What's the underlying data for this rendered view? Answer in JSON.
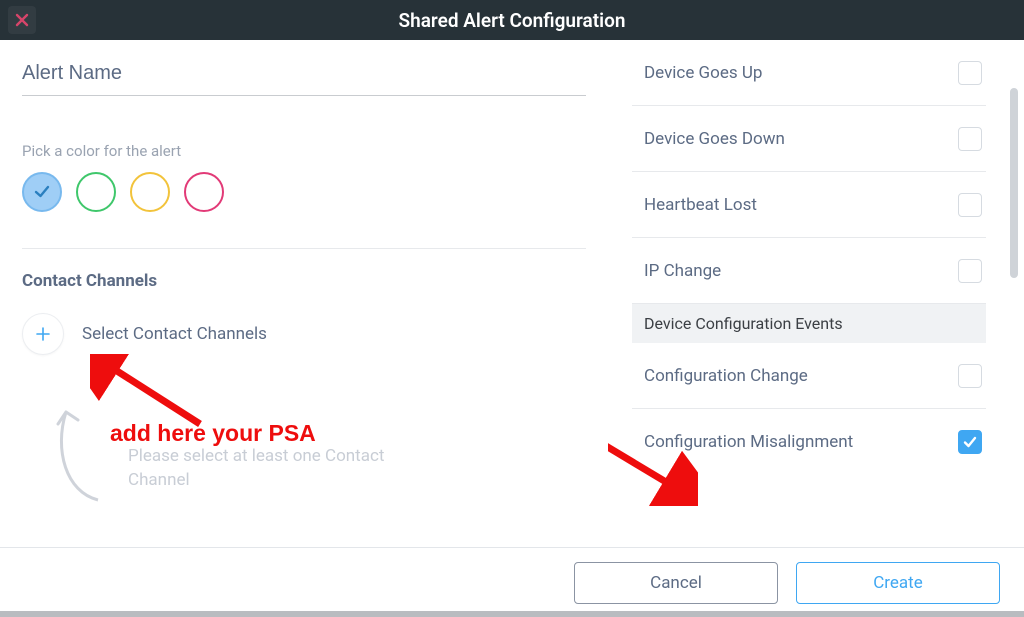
{
  "titlebar": {
    "title": "Shared Alert Configuration"
  },
  "left": {
    "alert_name_placeholder": "Alert Name",
    "pick_color_label": "Pick a color for the alert",
    "colors": [
      {
        "hex": "#78b9ee",
        "selected": true
      },
      {
        "hex": "#3fc76b",
        "selected": false
      },
      {
        "hex": "#f2c33b",
        "selected": false
      },
      {
        "hex": "#e23a77",
        "selected": false
      }
    ],
    "contact_channels_title": "Contact Channels",
    "select_channels_label": "Select Contact Channels",
    "hint": "Please select at least one Contact Channel"
  },
  "right": {
    "items": [
      {
        "type": "row",
        "label": "Device Goes Up",
        "checked": false
      },
      {
        "type": "row",
        "label": "Device Goes Down",
        "checked": false
      },
      {
        "type": "row",
        "label": "Heartbeat Lost",
        "checked": false
      },
      {
        "type": "row",
        "label": "IP Change",
        "checked": false
      },
      {
        "type": "section",
        "label": "Device Configuration Events"
      },
      {
        "type": "row",
        "label": "Configuration Change",
        "checked": false
      },
      {
        "type": "row",
        "label": "Configuration Misalignment",
        "checked": true
      }
    ]
  },
  "footer": {
    "cancel": "Cancel",
    "create": "Create"
  },
  "annotations": {
    "label": "add here your PSA"
  }
}
